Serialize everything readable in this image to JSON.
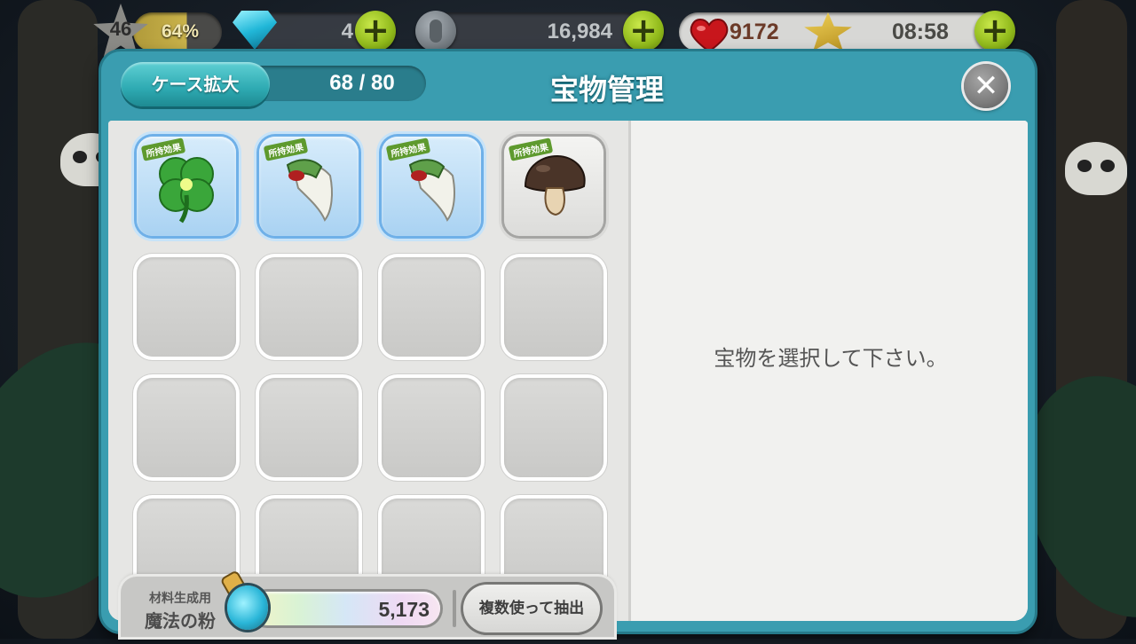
{
  "hud": {
    "level": "46",
    "xp_percent": "64%",
    "gems": "4",
    "coins": "16,984",
    "hearts": "9172",
    "timer": "08:58",
    "plus_symbol": "+",
    "icons": [
      "star-level-icon",
      "diamond-gem-icon",
      "coin-icon",
      "heart-icon",
      "key-star-icon"
    ]
  },
  "dialog": {
    "expand_button": "ケース拡大",
    "capacity": "68 / 80",
    "title": "宝物管理",
    "close_symbol": "✕"
  },
  "grid": {
    "tag_label": "所持効果",
    "items": [
      {
        "name": "four-leaf-clover",
        "frame": "blue",
        "color": "#3aa63a"
      },
      {
        "name": "fang-with-cloth",
        "frame": "blue",
        "color": "#f2f2ea"
      },
      {
        "name": "fang-with-cloth",
        "frame": "blue",
        "color": "#f2f2ea"
      },
      {
        "name": "brown-mushroom",
        "frame": "gray",
        "color": "#4a3428"
      }
    ],
    "empty_slots": 12
  },
  "detail": {
    "prompt": "宝物を選択して下さい。"
  },
  "bottom": {
    "material_small": "材料生成用",
    "material_big": "魔法の粉",
    "powder_value": "5,173",
    "extract_button": "複数使って抽出"
  }
}
